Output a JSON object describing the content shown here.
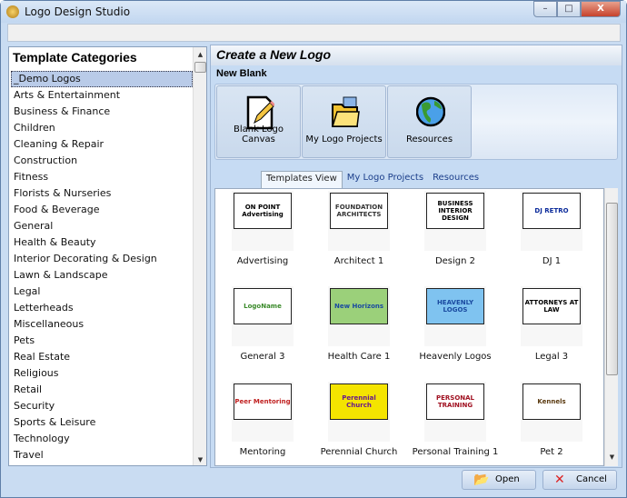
{
  "window": {
    "title": "Logo Design Studio",
    "minimize": "–",
    "maximize": "□",
    "close": "X"
  },
  "sidebar": {
    "title": "Template Categories",
    "selected": "_Demo Logos",
    "items": [
      "_Demo Logos",
      "Arts & Entertainment",
      "Business & Finance",
      "Children",
      "Cleaning & Repair",
      "Construction",
      "Fitness",
      "Florists & Nurseries",
      "Food & Beverage",
      "General",
      "Health & Beauty",
      "Interior Decorating & Design",
      "Lawn & Landscape",
      "Legal",
      "Letterheads",
      "Miscellaneous",
      "Pets",
      "Real Estate",
      "Religious",
      "Retail",
      "Security",
      "Sports & Leisure",
      "Technology",
      "Travel"
    ]
  },
  "main": {
    "title": "Create a New Logo",
    "section": "New Blank",
    "buttons": [
      {
        "label": "Blank Logo Canvas",
        "icon": "pencil-page-icon"
      },
      {
        "label": "My Logo Projects",
        "icon": "folder-icon"
      },
      {
        "label": "Resources",
        "icon": "globe-icon"
      }
    ],
    "tabs": [
      {
        "label": "Templates View",
        "active": true
      },
      {
        "label": "My Logo Projects"
      },
      {
        "label": "Resources"
      }
    ],
    "templates": [
      {
        "name": "Advertising",
        "logo": "ON POINT Advertising"
      },
      {
        "name": "Architect 1",
        "logo": "FOUNDATION ARCHITECTS"
      },
      {
        "name": "Design 2",
        "logo": "BUSINESS INTERIOR DESIGN"
      },
      {
        "name": "DJ 1",
        "logo": "DJ RETRO"
      },
      {
        "name": "General 3",
        "logo": "LogoName"
      },
      {
        "name": "Health Care 1",
        "logo": "New Horizons"
      },
      {
        "name": "Heavenly Logos",
        "logo": "HEAVENLY LOGOS"
      },
      {
        "name": "Legal 3",
        "logo": "ATTORNEYS AT LAW"
      },
      {
        "name": "Mentoring",
        "logo": "Peer Mentoring"
      },
      {
        "name": "Perennial Church",
        "logo": "Perennial Church"
      },
      {
        "name": "Personal Training 1",
        "logo": "PERSONAL TRAINING"
      },
      {
        "name": "Pet 2",
        "logo": "Kennels"
      }
    ]
  },
  "footer": {
    "open": "Open",
    "cancel": "Cancel"
  }
}
